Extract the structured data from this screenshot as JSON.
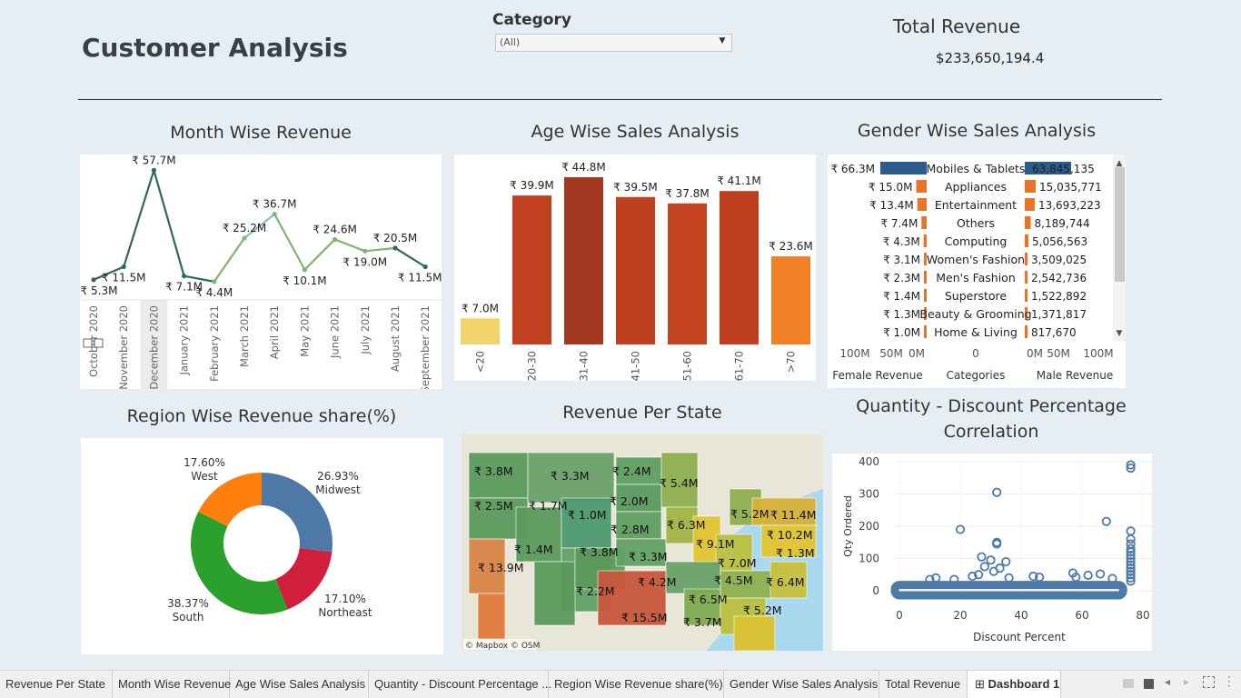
{
  "header": {
    "title": "Customer Analysis",
    "category_label": "Category",
    "category_value": "(All)",
    "total_revenue_label": "Total Revenue",
    "total_revenue_value": "$233,650,194.4"
  },
  "sections": {
    "month": "Month Wise Revenue",
    "age": "Age Wise Sales Analysis",
    "gender": "Gender Wise Sales Analysis",
    "region": "Region Wise Revenue share(%)",
    "state": "Revenue Per State",
    "qty_line1": "Quantity - Discount Percentage",
    "qty_line2": "Correlation"
  },
  "chart_data": [
    {
      "type": "line",
      "title": "Month Wise Revenue",
      "categories": [
        "October 2020",
        "November 2020",
        "December 2020",
        "January 2021",
        "February 2021",
        "March 2021",
        "April 2021",
        "May 2021",
        "June 2021",
        "July 2021",
        "August 2021",
        "September 2021"
      ],
      "values": [
        5.3,
        11.5,
        57.7,
        7.1,
        4.4,
        25.2,
        36.7,
        10.1,
        24.6,
        19.0,
        20.5,
        11.5
      ],
      "labels": [
        "₹ 5.3M",
        "₹ 11.5M",
        "₹ 57.7M",
        "₹ 7.1M",
        "₹ 4.4M",
        "₹ 25.2M",
        "₹ 36.7M",
        "₹ 10.1M",
        "₹ 24.6M",
        "₹ 19.0M",
        "₹ 20.5M",
        "₹ 11.5M"
      ],
      "highlighted_category": "December 2020"
    },
    {
      "type": "bar",
      "title": "Age Wise Sales Analysis",
      "categories": [
        "<20",
        "20-30",
        "31-40",
        "41-50",
        "51-60",
        "61-70",
        ">70"
      ],
      "values": [
        7.0,
        39.9,
        44.8,
        39.5,
        37.8,
        41.1,
        23.6
      ],
      "labels": [
        "₹ 7.0M",
        "₹ 39.9M",
        "₹ 44.8M",
        "₹ 39.5M",
        "₹ 37.8M",
        "₹ 41.1M",
        "₹ 23.6M"
      ],
      "colors": [
        "#f2d36b",
        "#c0401f",
        "#a2381f",
        "#bf401f",
        "#c3421f",
        "#bd3f1e",
        "#f07f26"
      ]
    },
    {
      "type": "bar",
      "title": "Gender Wise Sales Analysis",
      "categories": [
        "Mobiles & Tablets",
        "Appliances",
        "Entertainment",
        "Others",
        "Computing",
        "Women's Fashion",
        "Men's Fashion",
        "Superstore",
        "Beauty & Grooming",
        "Home & Living"
      ],
      "series": [
        {
          "name": "Female Revenue",
          "values": [
            66.3,
            15.0,
            13.4,
            7.4,
            4.3,
            3.1,
            2.3,
            1.4,
            1.3,
            1.0
          ],
          "labels": [
            "₹ 66.3M",
            "₹ 15.0M",
            "₹ 13.4M",
            "₹ 7.4M",
            "₹ 4.3M",
            "₹ 3.1M",
            "₹ 2.3M",
            "₹ 1.4M",
            "₹ 1.3M",
            "₹ 1.0M"
          ]
        },
        {
          "name": "Male Revenue",
          "values": [
            63845135,
            15035771,
            13693223,
            8189744,
            5056563,
            3509025,
            2542736,
            1522892,
            1371817,
            817670
          ],
          "labels": [
            "63,845,135",
            "15,035,771",
            "13,693,223",
            "8,189,744",
            "5,056,563",
            "3,509,025",
            "2,542,736",
            "1,522,892",
            "1,371,817",
            "817,670"
          ]
        }
      ],
      "axis_left_ticks": [
        "100M",
        "50M",
        "0M"
      ],
      "axis_mid_tick": "0",
      "axis_right_ticks": [
        "0M",
        "50M",
        "100M"
      ],
      "axis_labels": {
        "left": "Female Revenue",
        "mid": "Categories",
        "right": "Male Revenue"
      }
    },
    {
      "type": "pie",
      "title": "Region Wise Revenue share(%)",
      "slices": [
        {
          "name": "Midwest",
          "value": 26.93,
          "label": "26.93%",
          "color": "#4e79a7"
        },
        {
          "name": "Northeast",
          "value": 17.1,
          "label": "17.10%",
          "color": "#d01f3c"
        },
        {
          "name": "South",
          "value": 38.37,
          "label": "38.37%",
          "color": "#2ca02c"
        },
        {
          "name": "West",
          "value": 17.6,
          "label": "17.60%",
          "color": "#ff7f0e"
        }
      ]
    },
    {
      "type": "scatter",
      "title": "Quantity - Discount Percentage Correlation",
      "xlabel": "Discount Percent",
      "ylabel": "Qty Ordered",
      "x_ticks": [
        0,
        20,
        40,
        60,
        80
      ],
      "y_ticks": [
        0,
        100,
        200,
        300,
        400
      ],
      "xlim": [
        0,
        80
      ],
      "ylim": [
        0,
        400
      ],
      "points": [
        [
          32,
          305
        ],
        [
          76,
          390
        ],
        [
          76,
          380
        ],
        [
          20,
          190
        ],
        [
          68,
          215
        ],
        [
          76,
          185
        ],
        [
          32,
          150
        ],
        [
          32,
          145
        ],
        [
          76,
          160
        ],
        [
          76,
          145
        ],
        [
          27,
          105
        ],
        [
          30,
          95
        ],
        [
          35,
          90
        ],
        [
          76,
          130
        ],
        [
          76,
          120
        ],
        [
          76,
          110
        ],
        [
          76,
          100
        ],
        [
          76,
          90
        ],
        [
          28,
          75
        ],
        [
          33,
          70
        ],
        [
          31,
          60
        ],
        [
          76,
          80
        ],
        [
          76,
          70
        ],
        [
          76,
          60
        ],
        [
          76,
          50
        ],
        [
          76,
          40
        ],
        [
          76,
          30
        ],
        [
          66,
          52
        ],
        [
          62,
          48
        ],
        [
          57,
          55
        ],
        [
          24,
          45
        ],
        [
          36,
          40
        ],
        [
          12,
          40
        ],
        [
          18,
          35
        ],
        [
          10,
          35
        ],
        [
          44,
          45
        ],
        [
          46,
          42
        ],
        [
          58,
          42
        ],
        [
          70,
          38
        ],
        [
          26,
          50
        ]
      ]
    }
  ],
  "state_labels": [
    "₹ 3.8M",
    "₹ 3.3M",
    "₹ 2.4M",
    "₹ 5.4M",
    "₹ 2.5M",
    "₹ 1.7M",
    "₹ 2.0M",
    "₹ 1.0M",
    "₹ 2.8M",
    "₹ 6.3M",
    "₹ 5.2M",
    "₹ 11.4M",
    "₹ 10.2M",
    "₹ 9.1M",
    "₹ 1.4M",
    "₹ 3.8M",
    "₹ 3.3M",
    "₹ 1.3M",
    "₹ 13.9M",
    "₹ 7.0M",
    "₹ 4.2M",
    "₹ 4.5M",
    "₹ 6.4M",
    "₹ 2.2M",
    "₹ 6.5M",
    "₹ 15.5M",
    "₹ 3.7M",
    "₹ 5.2M"
  ],
  "map_attribution": "© Mapbox © OSM",
  "tabs": [
    "Revenue Per State",
    "Month Wise Revenue",
    "Age Wise Sales Analysis",
    "Quantity - Discount Percentage ...",
    "Region Wise Revenue share(%)",
    "Gender Wise Sales Analysis",
    "Total Revenue",
    "Dashboard 1"
  ],
  "colors": {
    "background": "#e6eef4",
    "line_dark": "#2e6b4f",
    "line_light": "#7fb56f",
    "female_bar": "#e8742a",
    "male_bar": "#2d5b8c",
    "scatter": "#4e7aa8"
  }
}
